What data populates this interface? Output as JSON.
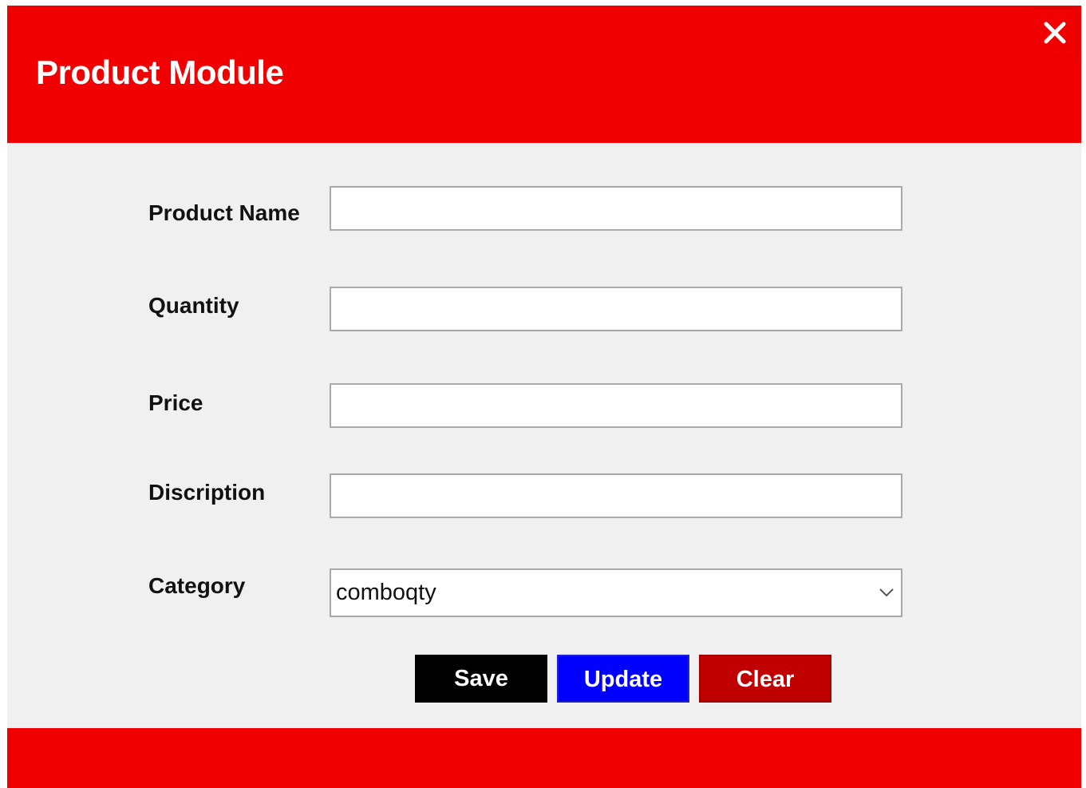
{
  "header": {
    "title": "Product Module",
    "close_icon": "close-icon",
    "color": "#f00000"
  },
  "form": {
    "product_name": {
      "label": "Product Name",
      "value": ""
    },
    "quantity": {
      "label": "Quantity",
      "value": ""
    },
    "price": {
      "label": "Price",
      "value": ""
    },
    "description": {
      "label": "Discription",
      "value": ""
    },
    "category": {
      "label": "Category",
      "value": "comboqty",
      "arrow_icon": "chevron-down-icon"
    }
  },
  "buttons": {
    "save": {
      "label": "Save",
      "color": "#000000"
    },
    "update": {
      "label": "Update",
      "color": "#0000ff"
    },
    "clear": {
      "label": "Clear",
      "color": "#c00000"
    }
  }
}
